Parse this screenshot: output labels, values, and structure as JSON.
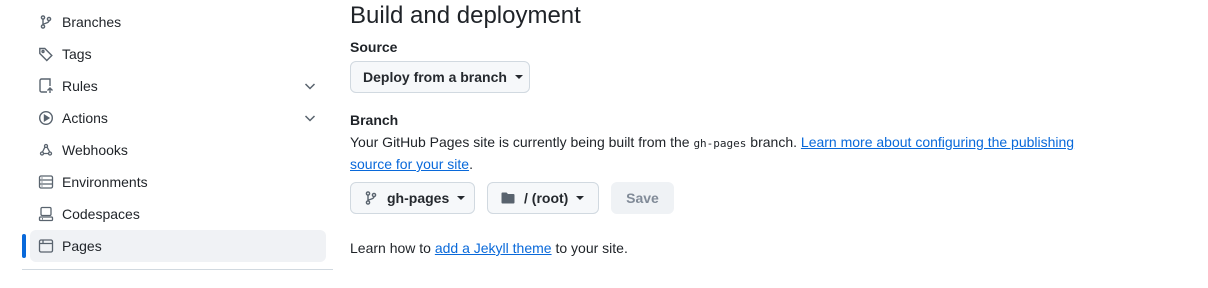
{
  "sidebar": {
    "items": [
      {
        "label": "Branches",
        "icon": "git-branch-icon"
      },
      {
        "label": "Tags",
        "icon": "tag-icon"
      },
      {
        "label": "Rules",
        "icon": "repo-push-icon",
        "expandable": true
      },
      {
        "label": "Actions",
        "icon": "play-icon",
        "expandable": true
      },
      {
        "label": "Webhooks",
        "icon": "webhook-icon"
      },
      {
        "label": "Environments",
        "icon": "server-icon"
      },
      {
        "label": "Codespaces",
        "icon": "codespaces-icon"
      },
      {
        "label": "Pages",
        "icon": "browser-icon",
        "active": true
      }
    ]
  },
  "main": {
    "title": "Build and deployment",
    "source": {
      "label": "Source",
      "selected": "Deploy from a branch"
    },
    "branch": {
      "label": "Branch",
      "desc_prefix": "Your GitHub Pages site is currently being built from the ",
      "branch_code": "gh-pages",
      "desc_middle": " branch. ",
      "learn_link": "Learn more about configuring the publishing source for your site",
      "desc_suffix": ".",
      "branch_button": "gh-pages",
      "folder_button": "/ (root)",
      "save_label": "Save"
    },
    "footer": {
      "prefix": "Learn how to ",
      "link": "add a Jekyll theme",
      "suffix": " to your site."
    }
  },
  "colors": {
    "accent": "#0969da",
    "text": "#1f2328",
    "muted_icon": "#59636e",
    "button_bg": "#f6f8fa",
    "active_bg": "#f0f2f5"
  }
}
